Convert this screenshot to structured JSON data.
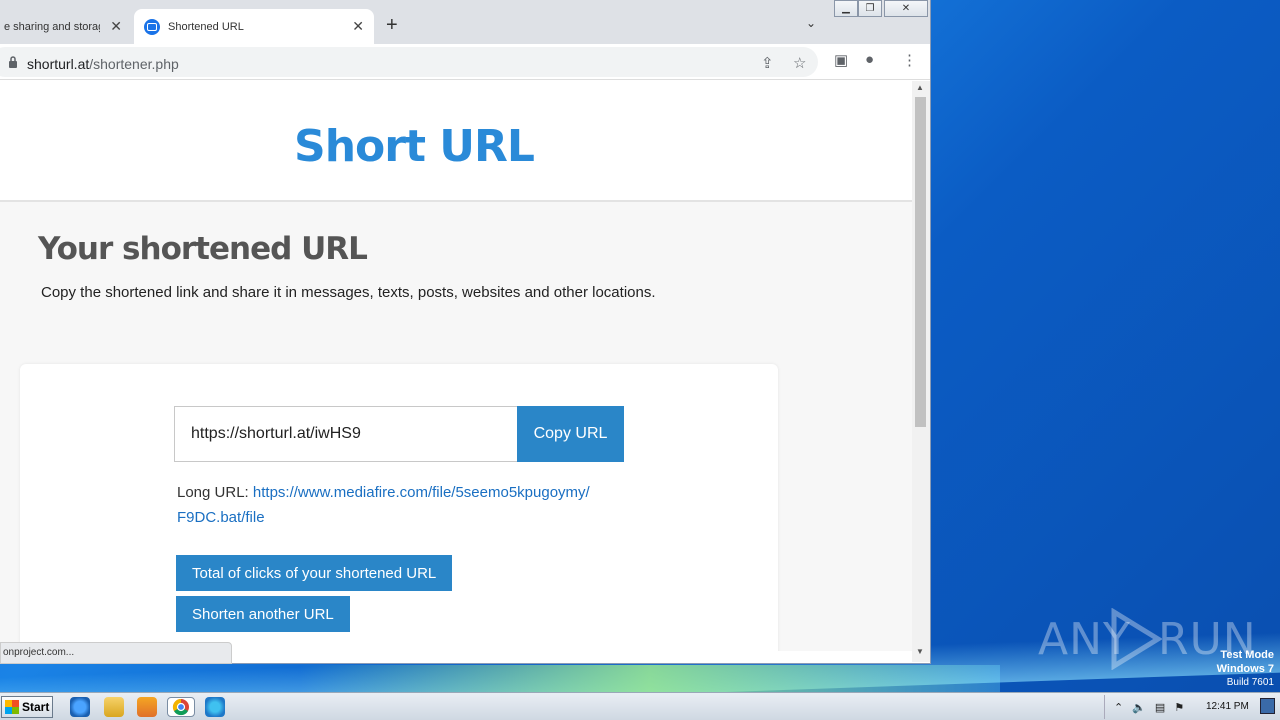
{
  "browser": {
    "tabs": [
      {
        "title": "e sharing and storage r",
        "active": false
      },
      {
        "title": "Shortened URL",
        "active": true
      }
    ],
    "address": {
      "domain": "shorturl.at",
      "path": "/shortener.php"
    },
    "status_text": "onproject.com..."
  },
  "page": {
    "logo": "Short URL",
    "heading": "Your shortened URL",
    "description": "Copy the shortened link and share it in messages, texts, posts, websites and other locations.",
    "short_url": "https://shorturl.at/iwHS9",
    "copy_label": "Copy URL",
    "long_url_label": "Long URL:",
    "long_url_line1": "https://www.mediafire.com/file/5seemo5kpugoymy/",
    "long_url_line2": "F9DC.bat/file",
    "clicks_label": "Total of clicks of your shortened URL",
    "another_label": "Shorten another URL"
  },
  "desktop": {
    "watermark_left": "ANY",
    "watermark_right": "RUN",
    "os_line1": "Test Mode",
    "os_line2": "Windows 7",
    "os_line3": "Build 7601"
  },
  "taskbar": {
    "start_label": "Start",
    "clock": "12:41 PM"
  },
  "colors": {
    "accent": "#2a86c8",
    "logo": "#2a8ad8",
    "link": "#1a6fc2"
  }
}
